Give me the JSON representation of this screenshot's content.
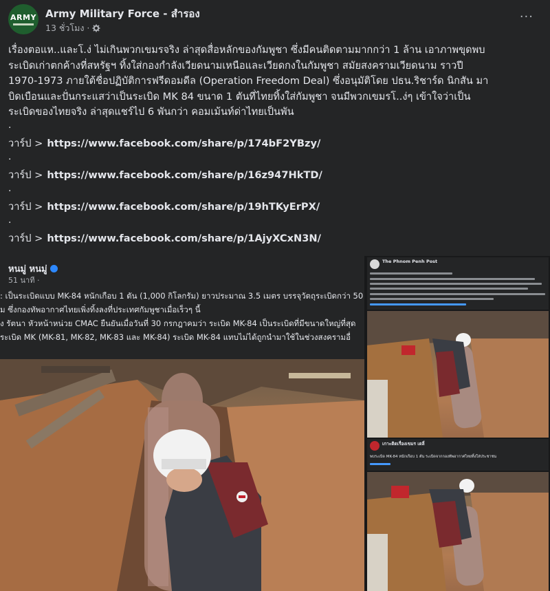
{
  "header": {
    "logo_text": "ARMY",
    "page_name": "Army Military Force - สำรอง",
    "time": "13 ชั่วโมง ·",
    "more": "···"
  },
  "post": {
    "paragraph": "เรื่องตอแห..และโ.ง่ ไม่เกินพวกเขมรจริง ล่าสุดสื่อหลักของกัมพูชา ซึ่งมีคนติดตามมากกว่า 1 ล้าน เอาภาพขุดพบ\nระเบิดเก่าตกค้างที่สหรัฐฯ ทิ้งใส่กองกำลังเวียดนามเหนือและเวียดกงในกัมพูชา สมัยสงครามเวียดนาม ราวปี\n1970-1973 ภายใต้ชื่อปฏิบัติการฟรีดอมดีล (Operation Freedom Deal) ซึ่งอนุมัติโดย ปธน.ริชาร์ด นิกสัน มา\nบิดเบือนและปั่นกระแสว่าเป็นระเบิด MK 84 ขนาด 1 ตันที่ไทยทิ้งใส่กัมพูชา จนมีพวกเขมรโ..ง่ๆ เข้าใจว่าเป็น\nระเบิดของไทยจริง ล่าสุดแชร์ไป 6 พันกว่า คอมเม้นท์ด่าไทยเป็นพัน",
    "dot": ".",
    "links": [
      {
        "label": "วาร์ป >",
        "url": "https://www.facebook.com/share/p/174bF2YBzy/"
      },
      {
        "label": "วาร์ป >",
        "url": "https://www.facebook.com/share/p/16z947HkTD/"
      },
      {
        "label": "วาร์ป >",
        "url": "https://www.facebook.com/share/p/19hTKyErPX/"
      },
      {
        "label": "วาร์ป >",
        "url": "https://www.facebook.com/share/p/1AjyXCxN3N/"
      }
    ]
  },
  "embedded_left": {
    "name": "หนมู่ หนมู่",
    "time": "51 นาที ·",
    "line1": ": เป็นระเบิดแบบ MK-84 หนักเกือบ 1 ตัน (1,000 กิโลกรัม) ยาวประมาณ 3.5 เมตร บรรจุวัตถุระเบิดกว่า 50",
    "line2": "ม ซึ่งกองทัพอากาศไทยเพิ่งทิ้งลงที่ประเทศกัมพูชาเมื่อเร็วๆ นี้",
    "line3": "ง รัตนา หัวหน้าหน่วย CMAC ยืนยันเมื่อวันที่ 30 กรกฎาคมว่า ระเบิด MK-84 เป็นระเบิดที่มีขนาดใหญ่ที่สุด",
    "line4": "ระเบิด MK (MK-81, MK-82, MK-83 และ MK-84) ระเบิด MK-84 แทบไม่ได้ถูกนำมาใช้ในช่วงสงครามอื่"
  },
  "embedded_right": {
    "top_name": "The Phnom Penh Post",
    "bottom_name": "เกาะติดเรื่องเขมร เดลี่",
    "bottom_text": "พบระเบิด MK-84 หนักเกือบ 1 ตัน ระเบิดจากกองทัพอากาศไทยทิ้งใส่ประชาชน"
  },
  "colors": {
    "background": "#242526",
    "text": "#e4e6eb",
    "muted": "#b0b3b8",
    "accent": "#2d88ff"
  }
}
